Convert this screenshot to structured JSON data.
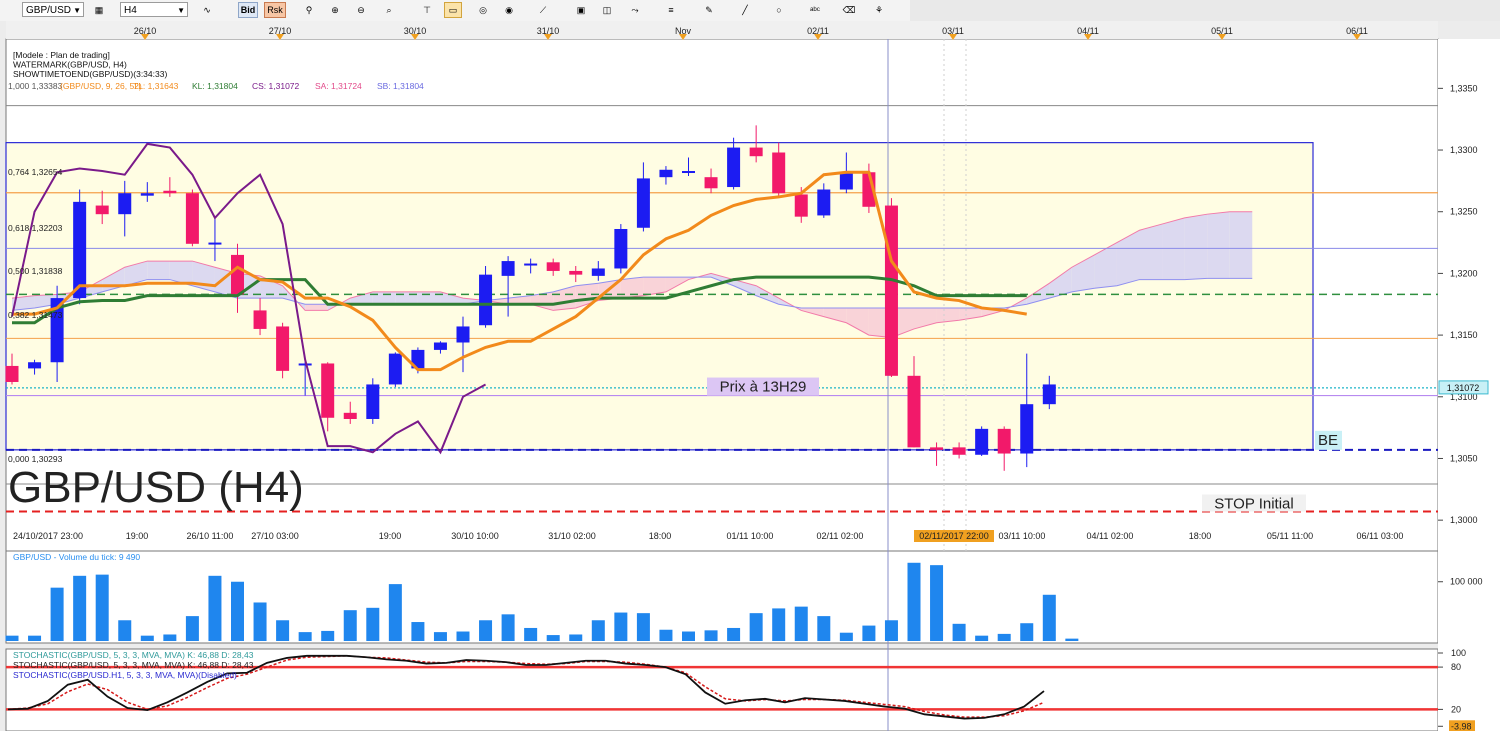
{
  "toolbar": {
    "symbol": "GBP/USD",
    "timeframe": "H4",
    "bid_label": "Bid",
    "risk_label": "Rsk",
    "icons": [
      "layout-icon",
      "chart-type-icon",
      "bid-icon",
      "risk-icon",
      "objects-icon",
      "zoom-in-icon",
      "zoom-out-icon",
      "zoom-fit-icon",
      "pin-icon",
      "note-icon",
      "globe-icon",
      "ruler-icon",
      "image-icon",
      "chart-icon",
      "draw-line-icon",
      "indicator-icon",
      "shape-icon",
      "color-icon",
      "circle-icon",
      "text-icon",
      "eraser-icon",
      "tree-icon"
    ]
  },
  "colors": {
    "bull": "#1c1cf2",
    "bear": "#f2196a",
    "orange": "#f28a1b",
    "green": "#2f7d34",
    "purple": "#7a1a8a",
    "fib_orange": "#f5a04a",
    "blue_line": "#2b2bd6",
    "red_dash": "#e52020",
    "navy_dash": "#1a1ac0"
  },
  "chart_data": [
    {
      "type": "candlestick",
      "name": "price",
      "header_lines": [
        "[Modele : Plan de trading]",
        "WATERMARK(GBP/USD, H4)",
        "SHOWTIMETOEND(GBP/USD)(3:34:33)"
      ],
      "indicator_line": {
        "prefix": "1,000  1,33383",
        "ichimoku": "(GBP/USD, 9, 26, 52)",
        "tl": "TL: 1,31643",
        "kl": "KL: 1,31804",
        "cs": "CS: 1,31072",
        "sa": "SA: 1,31724",
        "sb": "SB: 1,31804"
      },
      "watermark": "GBP/USD (H4)",
      "ylim": [
        1.2975,
        1.339
      ],
      "y_ticks": [
        "1,3000",
        "1,3050",
        "1,3100",
        "1,3150",
        "1,3200",
        "1,3250",
        "1,3300",
        "1,3350"
      ],
      "last_price": "1,31072",
      "top_dates": [
        "26/10",
        "27/10",
        "30/10",
        "31/10",
        "Nov",
        "02/11",
        "03/11",
        "04/11",
        "05/11",
        "06/11"
      ],
      "bottom_times": [
        "24/10/2017 23:00",
        "19:00",
        "26/10 11:00",
        "27/10 03:00",
        "19:00",
        "30/10 10:00",
        "31/10 02:00",
        "18:00",
        "01/11 10:00",
        "02/11 02:00",
        "02/11/2017 22:00",
        "03/11 10:00",
        "04/11 02:00",
        "18:00",
        "05/11 11:00",
        "06/11 03:00"
      ],
      "fib_levels": [
        {
          "label": "0,764  1,32654",
          "value": 1.32654
        },
        {
          "label": "0,618  1,32203",
          "value": 1.32203
        },
        {
          "label": "0,500  1,31838",
          "value": 1.31838
        },
        {
          "label": "0,382  1,31473",
          "value": 1.31473
        },
        {
          "label": "0,000  1,30293",
          "value": 1.30293
        }
      ],
      "annotations": {
        "price_label": "Prix à 13H29",
        "be_label": "BE",
        "stop_label": "STOP Initial"
      },
      "lines": {
        "box_top": 1.3306,
        "be": 1.3057,
        "stop": 1.3007,
        "price_cyan": 1.31072,
        "price_violet": 1.3101,
        "green_dash": 1.3183
      },
      "candles": [
        {
          "o": 1.3125,
          "h": 1.3135,
          "l": 1.311,
          "c": 1.3112
        },
        {
          "o": 1.3123,
          "h": 1.313,
          "l": 1.3118,
          "c": 1.3128
        },
        {
          "o": 1.3128,
          "h": 1.319,
          "l": 1.3112,
          "c": 1.318
        },
        {
          "o": 1.318,
          "h": 1.3268,
          "l": 1.3175,
          "c": 1.3258
        },
        {
          "o": 1.3255,
          "h": 1.3267,
          "l": 1.324,
          "c": 1.3248
        },
        {
          "o": 1.3248,
          "h": 1.3275,
          "l": 1.323,
          "c": 1.3265
        },
        {
          "o": 1.3263,
          "h": 1.3274,
          "l": 1.3258,
          "c": 1.3265
        },
        {
          "o": 1.3267,
          "h": 1.3278,
          "l": 1.3262,
          "c": 1.3265
        },
        {
          "o": 1.3265,
          "h": 1.3268,
          "l": 1.3222,
          "c": 1.3224
        },
        {
          "o": 1.3224,
          "h": 1.3246,
          "l": 1.321,
          "c": 1.3225
        },
        {
          "o": 1.3215,
          "h": 1.3224,
          "l": 1.3168,
          "c": 1.3183
        },
        {
          "o": 1.317,
          "h": 1.318,
          "l": 1.315,
          "c": 1.3155
        },
        {
          "o": 1.3157,
          "h": 1.316,
          "l": 1.3115,
          "c": 1.3121
        },
        {
          "o": 1.3126,
          "h": 1.3129,
          "l": 1.3101,
          "c": 1.3127
        },
        {
          "o": 1.3127,
          "h": 1.3128,
          "l": 1.3072,
          "c": 1.3083
        },
        {
          "o": 1.3087,
          "h": 1.3096,
          "l": 1.3078,
          "c": 1.3082
        },
        {
          "o": 1.3082,
          "h": 1.3115,
          "l": 1.3078,
          "c": 1.311
        },
        {
          "o": 1.311,
          "h": 1.3136,
          "l": 1.3108,
          "c": 1.3135
        },
        {
          "o": 1.3123,
          "h": 1.314,
          "l": 1.3119,
          "c": 1.3138
        },
        {
          "o": 1.3138,
          "h": 1.3145,
          "l": 1.3135,
          "c": 1.3144
        },
        {
          "o": 1.3144,
          "h": 1.3165,
          "l": 1.312,
          "c": 1.3157
        },
        {
          "o": 1.3158,
          "h": 1.3206,
          "l": 1.3156,
          "c": 1.3199
        },
        {
          "o": 1.3198,
          "h": 1.3214,
          "l": 1.3165,
          "c": 1.321
        },
        {
          "o": 1.3208,
          "h": 1.3212,
          "l": 1.32,
          "c": 1.3208
        },
        {
          "o": 1.3209,
          "h": 1.3212,
          "l": 1.3198,
          "c": 1.3202
        },
        {
          "o": 1.3202,
          "h": 1.3206,
          "l": 1.3193,
          "c": 1.3199
        },
        {
          "o": 1.3198,
          "h": 1.321,
          "l": 1.3194,
          "c": 1.3204
        },
        {
          "o": 1.3204,
          "h": 1.324,
          "l": 1.32,
          "c": 1.3236
        },
        {
          "o": 1.3237,
          "h": 1.329,
          "l": 1.3234,
          "c": 1.3277
        },
        {
          "o": 1.3278,
          "h": 1.3287,
          "l": 1.3272,
          "c": 1.3284
        },
        {
          "o": 1.3282,
          "h": 1.3294,
          "l": 1.3279,
          "c": 1.3283
        },
        {
          "o": 1.3278,
          "h": 1.3285,
          "l": 1.3265,
          "c": 1.3269
        },
        {
          "o": 1.327,
          "h": 1.331,
          "l": 1.3268,
          "c": 1.3302
        },
        {
          "o": 1.3302,
          "h": 1.332,
          "l": 1.329,
          "c": 1.3295
        },
        {
          "o": 1.3298,
          "h": 1.3306,
          "l": 1.3262,
          "c": 1.3265
        },
        {
          "o": 1.3264,
          "h": 1.327,
          "l": 1.3241,
          "c": 1.3246
        },
        {
          "o": 1.3247,
          "h": 1.3273,
          "l": 1.3245,
          "c": 1.3268
        },
        {
          "o": 1.3268,
          "h": 1.3298,
          "l": 1.3265,
          "c": 1.3281
        },
        {
          "o": 1.3282,
          "h": 1.3289,
          "l": 1.3249,
          "c": 1.3254
        },
        {
          "o": 1.3255,
          "h": 1.3261,
          "l": 1.3116,
          "c": 1.3117
        },
        {
          "o": 1.3117,
          "h": 1.3133,
          "l": 1.3059,
          "c": 1.3059
        },
        {
          "o": 1.3059,
          "h": 1.3063,
          "l": 1.3044,
          "c": 1.3057
        },
        {
          "o": 1.3059,
          "h": 1.3063,
          "l": 1.305,
          "c": 1.3053
        },
        {
          "o": 1.3053,
          "h": 1.3076,
          "l": 1.3052,
          "c": 1.3074
        },
        {
          "o": 1.3074,
          "h": 1.3076,
          "l": 1.304,
          "c": 1.3054
        },
        {
          "o": 1.3054,
          "h": 1.3135,
          "l": 1.3043,
          "c": 1.3094
        },
        {
          "o": 1.3094,
          "h": 1.3117,
          "l": 1.309,
          "c": 1.311
        }
      ],
      "orange_tl": [
        1.3167,
        1.3167,
        1.3172,
        1.319,
        1.319,
        1.319,
        1.3192,
        1.3192,
        1.3192,
        1.319,
        1.3205,
        1.3195,
        1.3193,
        1.318,
        1.318,
        1.3173,
        1.3162,
        1.314,
        1.3122,
        1.3122,
        1.3132,
        1.314,
        1.3145,
        1.3145,
        1.3155,
        1.3165,
        1.318,
        1.3195,
        1.3215,
        1.3228,
        1.3235,
        1.3247,
        1.3255,
        1.326,
        1.3262,
        1.3265,
        1.328,
        1.3282,
        1.3282,
        1.321,
        1.3185,
        1.318,
        1.3178,
        1.3172,
        1.317,
        1.3167
      ],
      "green_kl": [
        1.316,
        1.316,
        1.3172,
        1.3177,
        1.3178,
        1.3178,
        1.3182,
        1.3182,
        1.3182,
        1.3182,
        1.3182,
        1.3195,
        1.3195,
        1.3195,
        1.3175,
        1.3175,
        1.3175,
        1.3175,
        1.3175,
        1.3175,
        1.3175,
        1.3175,
        1.3175,
        1.3175,
        1.3175,
        1.3178,
        1.318,
        1.318,
        1.318,
        1.318,
        1.3185,
        1.319,
        1.3195,
        1.3197,
        1.3197,
        1.3197,
        1.3197,
        1.3197,
        1.3197,
        1.3195,
        1.319,
        1.3182,
        1.3182,
        1.3182,
        1.3182,
        1.3182
      ],
      "purple_cs": [
        1.3165,
        1.325,
        1.3282,
        1.3285,
        1.3283,
        1.328,
        1.3305,
        1.3302,
        1.328,
        1.3245,
        1.3265,
        1.328,
        1.324,
        1.313,
        1.306,
        1.306,
        1.3055,
        1.307,
        1.308,
        1.3055,
        1.31,
        1.311
      ],
      "cloud_sa": [
        1.318,
        1.3182,
        1.3183,
        1.3185,
        1.3195,
        1.3205,
        1.321,
        1.321,
        1.321,
        1.3205,
        1.32,
        1.3198,
        1.319,
        1.317,
        1.317,
        1.318,
        1.3185,
        1.3185,
        1.3185,
        1.3185,
        1.318,
        1.3178,
        1.3175,
        1.3175,
        1.317,
        1.3172,
        1.3178,
        1.318,
        1.3182,
        1.3185,
        1.3195,
        1.32,
        1.3195,
        1.319,
        1.318,
        1.317,
        1.3165,
        1.316,
        1.315,
        1.3148,
        1.3155,
        1.316,
        1.3162,
        1.3165,
        1.317,
        1.318,
        1.3192,
        1.3205,
        1.3215,
        1.3225,
        1.3235,
        1.324,
        1.3245,
        1.3248,
        1.325,
        1.325
      ],
      "cloud_sb": [
        1.317,
        1.3172,
        1.3175,
        1.318,
        1.3185,
        1.319,
        1.3195,
        1.3195,
        1.319,
        1.3185,
        1.318,
        1.318,
        1.318,
        1.3175,
        1.3175,
        1.3175,
        1.3175,
        1.3175,
        1.3175,
        1.3175,
        1.3175,
        1.3178,
        1.318,
        1.3182,
        1.3185,
        1.319,
        1.3192,
        1.3195,
        1.3197,
        1.3197,
        1.3197,
        1.3197,
        1.319,
        1.3182,
        1.3175,
        1.3172,
        1.3172,
        1.3172,
        1.3172,
        1.3172,
        1.3172,
        1.3172,
        1.3172,
        1.3172,
        1.3172,
        1.3175,
        1.318,
        1.3185,
        1.3188,
        1.319,
        1.3195,
        1.3195,
        1.3195,
        1.3196,
        1.3196,
        1.3196
      ]
    },
    {
      "type": "bar",
      "name": "volume",
      "label": "GBP/USD - Volume du tick: 9 490",
      "y_ticks": [
        "100 000"
      ],
      "ylim": [
        0,
        135000
      ],
      "values": [
        9000,
        9000,
        90000,
        110000,
        112000,
        35000,
        9000,
        11000,
        42000,
        110000,
        100000,
        65000,
        35000,
        15000,
        17000,
        52000,
        56000,
        96000,
        32000,
        15000,
        16000,
        35000,
        45000,
        22000,
        10000,
        11000,
        35000,
        48000,
        47000,
        19000,
        16000,
        18000,
        22000,
        47000,
        55000,
        58000,
        42000,
        14000,
        26000,
        35000,
        132000,
        128000,
        29000,
        9000,
        12000,
        30000,
        78000,
        4000
      ]
    },
    {
      "type": "line",
      "name": "stochastic",
      "labels": [
        "STOCHASTIC(GBP/USD, 5, 3, 3, MVA, MVA)  K: 46,88  D: 28,43",
        "STOCHASTIC(GBP/USD, 5, 3, 3, MVA, MVA)  K: 46,88  D: 28,43",
        "STOCHASTIC(GBP/USD.H1, 5, 3, 3, MVA, MVA)(Disabled)"
      ],
      "y_ticks": [
        "100",
        "80",
        "20",
        "-3.98"
      ],
      "ylim": [
        -5,
        100
      ],
      "k": [
        20,
        21,
        32,
        55,
        62,
        38,
        22,
        19,
        30,
        44,
        59,
        71,
        72,
        86,
        93,
        96,
        96,
        96,
        94,
        91,
        89,
        85,
        86,
        90,
        89,
        87,
        83,
        83,
        86,
        89,
        89,
        85,
        83,
        80,
        70,
        44,
        28,
        33,
        35,
        30,
        36,
        34,
        32,
        28,
        24,
        21,
        13,
        10,
        7,
        8,
        13,
        24,
        46
      ],
      "d": [
        20,
        22,
        28,
        45,
        56,
        48,
        30,
        20,
        25,
        37,
        51,
        64,
        70,
        80,
        90,
        94,
        95,
        96,
        94,
        93,
        90,
        87,
        86,
        88,
        88,
        87,
        85,
        84,
        85,
        88,
        88,
        87,
        84,
        80,
        72,
        52,
        35,
        32,
        34,
        32,
        34,
        34,
        33,
        30,
        27,
        24,
        17,
        12,
        9,
        9,
        11,
        18,
        30
      ]
    }
  ]
}
